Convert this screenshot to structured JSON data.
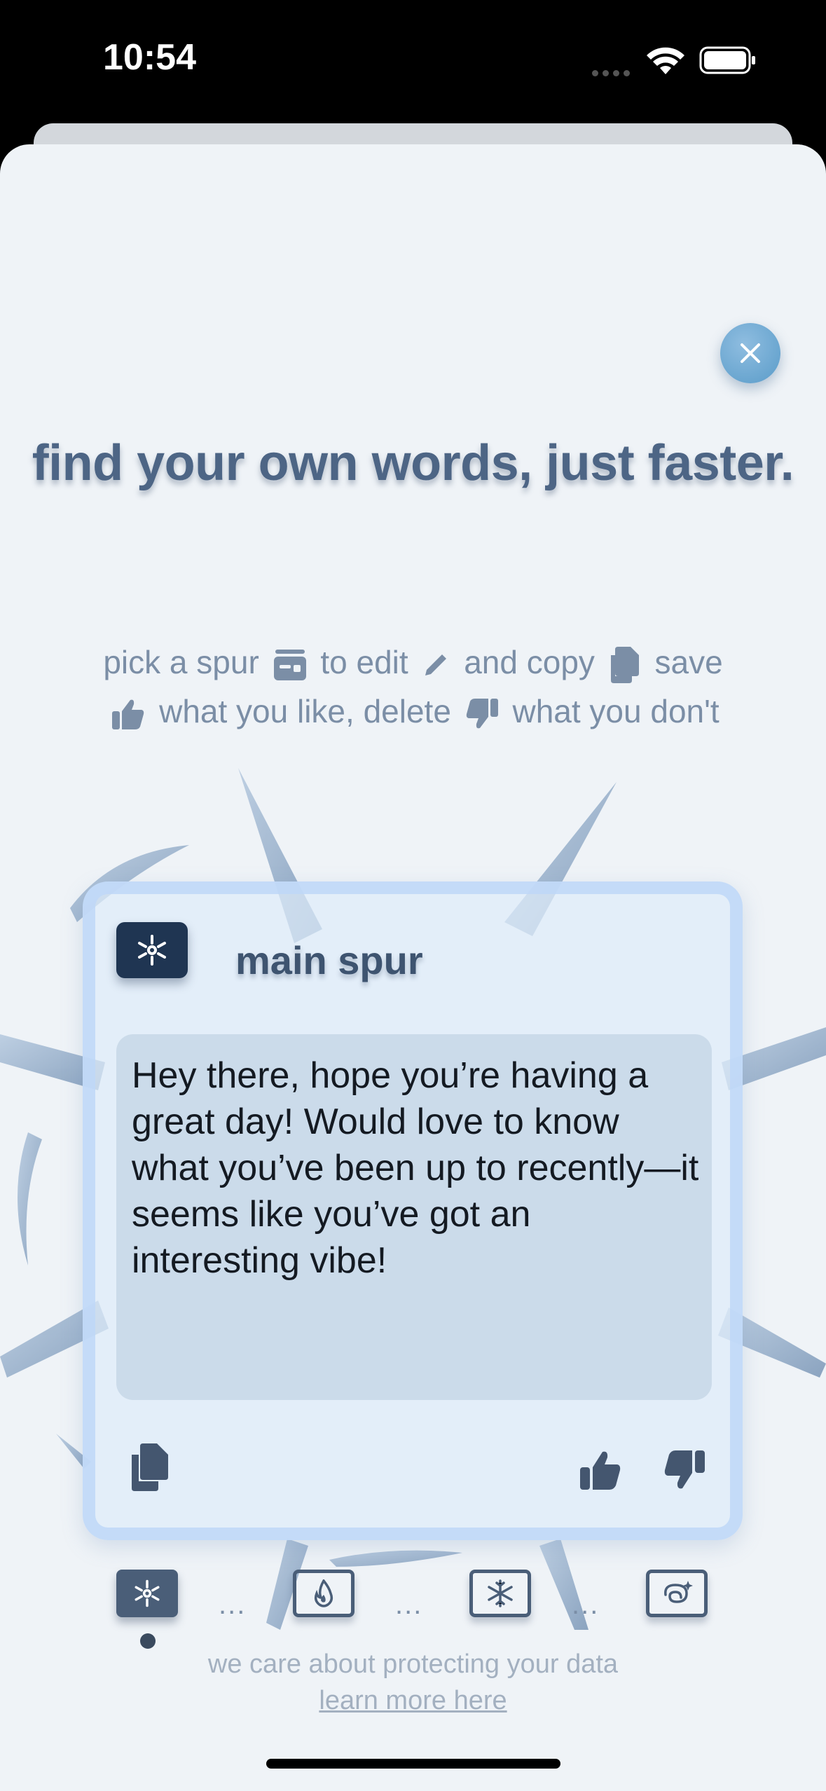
{
  "status_bar": {
    "time": "10:54"
  },
  "sheet": {
    "headline": "find your own words, just faster.",
    "instructions": {
      "pick": "pick a spur",
      "to_edit": "to edit",
      "and_copy": "and copy",
      "save": "save",
      "what_you_like": "what you like, delete",
      "what_you_dont": "what you don't"
    },
    "card": {
      "title": "main spur",
      "message": "Hey there, hope you’re having a great day! Would love to know what you’ve been up to recently—it seems like you’ve got an interesting vibe!"
    },
    "selector": {
      "items": [
        "snowflake-asterisk-icon",
        "flame-icon",
        "snowflake-icon",
        "sparkle-loop-icon"
      ],
      "dots": "...",
      "active_index": 0
    },
    "footer": {
      "text": "we care about protecting your data",
      "link": "learn more here"
    }
  },
  "colors": {
    "background": "#eff3f7",
    "text_dark": "#3e5470",
    "text_muted": "#7b8ea6",
    "close_button": "#6aa8d4"
  }
}
